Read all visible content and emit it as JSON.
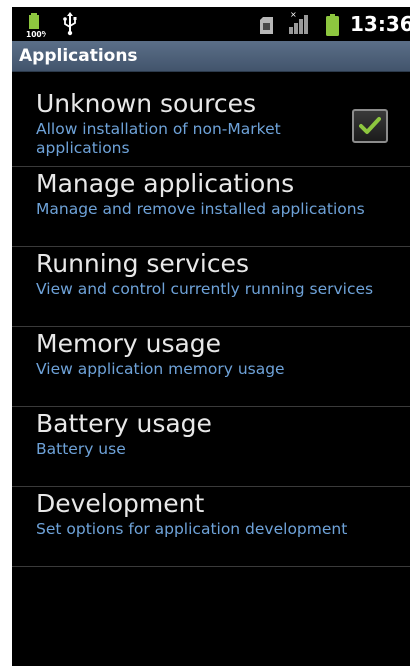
{
  "statusbar": {
    "battery_percent_label": "100%",
    "time": "13:36",
    "icons": [
      "battery-charging-icon",
      "usb-icon",
      "sim-card-icon",
      "signal-bars-icon",
      "battery-icon"
    ]
  },
  "titlebar": {
    "title": "Applications"
  },
  "items": [
    {
      "title": "Unknown sources",
      "subtitle": "Allow installation of non-Market applications",
      "checked": true
    },
    {
      "title": "Manage applications",
      "subtitle": "Manage and remove installed applications"
    },
    {
      "title": "Running services",
      "subtitle": "View and control currently running services"
    },
    {
      "title": "Memory usage",
      "subtitle": "View application memory usage"
    },
    {
      "title": "Battery usage",
      "subtitle": "Battery use"
    },
    {
      "title": "Development",
      "subtitle": "Set options for application development"
    }
  ],
  "colors": {
    "accent_green": "#8dc63f",
    "subtitle_blue": "#6ea2d8",
    "titlebar_blue": "#4d6079"
  }
}
